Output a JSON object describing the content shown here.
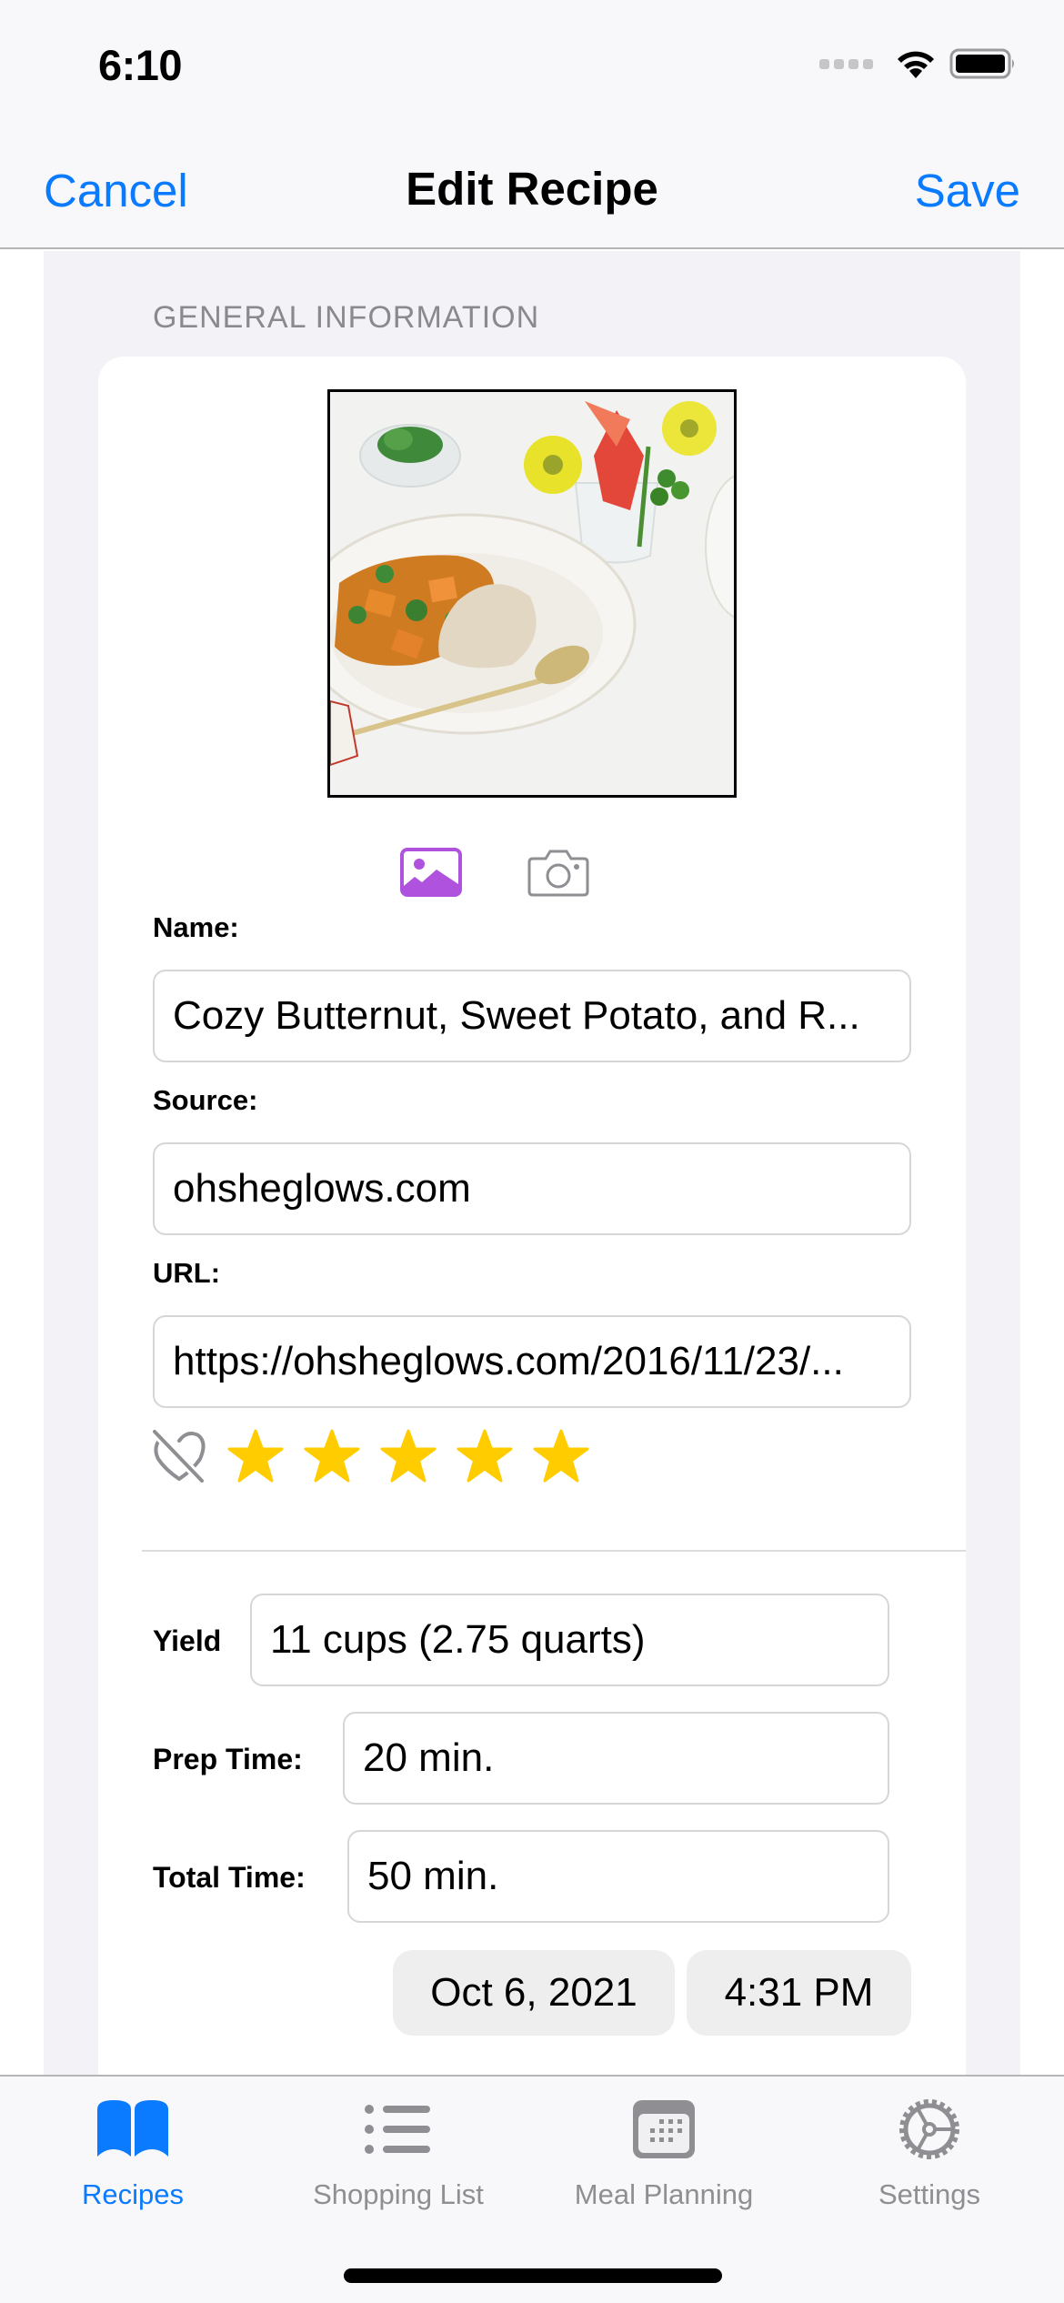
{
  "status_bar": {
    "time": "6:10"
  },
  "nav": {
    "cancel_label": "Cancel",
    "title": "Edit Recipe",
    "save_label": "Save"
  },
  "section": {
    "header": "GENERAL INFORMATION"
  },
  "photo": {
    "description": "Bowl of butternut and sweet potato stew over rice with cilantro, flowers in vase"
  },
  "media_actions": {
    "photo_library_icon": "photo-icon",
    "camera_icon": "camera-icon",
    "accent_color": "#AF52DE"
  },
  "fields": {
    "name": {
      "label": "Name:",
      "value": "Cozy Butternut, Sweet Potato, and R..."
    },
    "source": {
      "label": "Source:",
      "value": "ohsheglows.com"
    },
    "url": {
      "label": "URL:",
      "value": "https://ohsheglows.com/2016/11/23/..."
    }
  },
  "rating": {
    "favorite": false,
    "stars": 5,
    "max_stars": 5,
    "star_color": "#FFCC00"
  },
  "details": {
    "yield": {
      "label": "Yield",
      "value": "11 cups (2.75 quarts)"
    },
    "prep_time": {
      "label": "Prep Time:",
      "value": "20 min."
    },
    "total_time": {
      "label": "Total Time:",
      "value": "50 min."
    }
  },
  "datetime": {
    "date": "Oct 6, 2021",
    "time": "4:31 PM"
  },
  "tabbar": {
    "active_color": "#0A7AFF",
    "inactive_color": "#8E8E93",
    "items": [
      {
        "label": "Recipes",
        "icon": "book-icon",
        "active": true
      },
      {
        "label": "Shopping List",
        "icon": "list-icon",
        "active": false
      },
      {
        "label": "Meal Planning",
        "icon": "calendar-icon",
        "active": false
      },
      {
        "label": "Settings",
        "icon": "gear-icon",
        "active": false
      }
    ]
  }
}
